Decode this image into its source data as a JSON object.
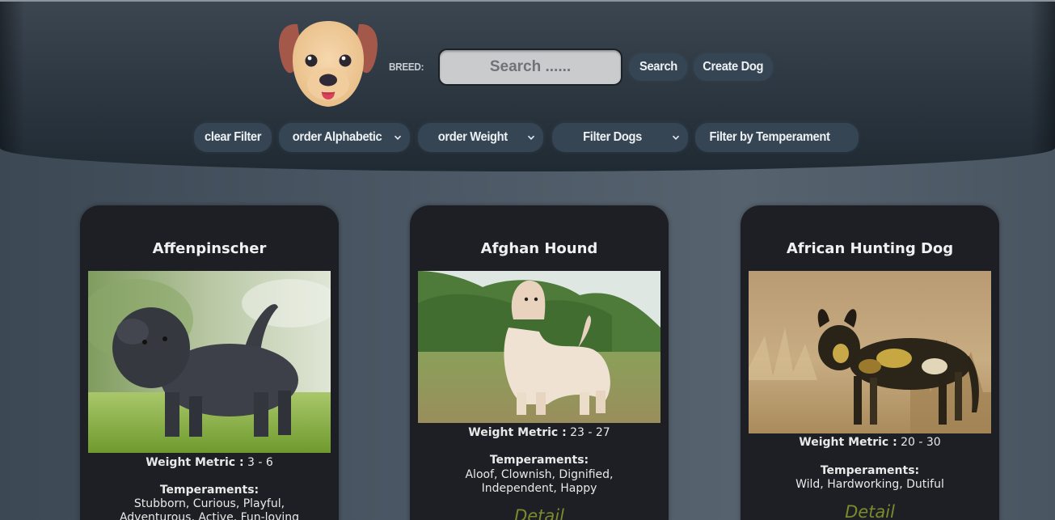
{
  "header": {
    "breed_label": "BREED:",
    "search": {
      "placeholder": "Search ......",
      "value": ""
    },
    "search_button": "Search",
    "create_button": "Create Dog",
    "filters": {
      "clear": "clear Filter",
      "order_alphabetic": "order Alphabetic",
      "order_weight": "order Weight",
      "filter_dogs": "Filter Dogs",
      "filter_temperament": "Filter by Temperament"
    },
    "logo_icon": "dog-face-icon"
  },
  "weight_label": "Weight Metric :",
  "temperaments_label": "Temperaments:",
  "detail_label": "Detail",
  "cards": [
    {
      "name": "Affenpinscher",
      "weight": "3 - 6",
      "temperaments": "Stubborn, Curious, Playful, Adventurous, Active, Fun-loving",
      "image": "black-shaggy-dog-photo"
    },
    {
      "name": "Afghan Hound",
      "weight": "23 - 27",
      "temperaments": "Aloof, Clownish, Dignified, Independent, Happy",
      "image": "cream-long-haired-dog-photo"
    },
    {
      "name": "African Hunting Dog",
      "weight": "20 - 30",
      "temperaments": "Wild, Hardworking, Dutiful",
      "image": "spotted-wild-dog-photo"
    }
  ],
  "colors": {
    "header_dark": "#202a33",
    "pill": "#364553",
    "card": "#1d1f24",
    "detail": "#7d8a2b"
  }
}
